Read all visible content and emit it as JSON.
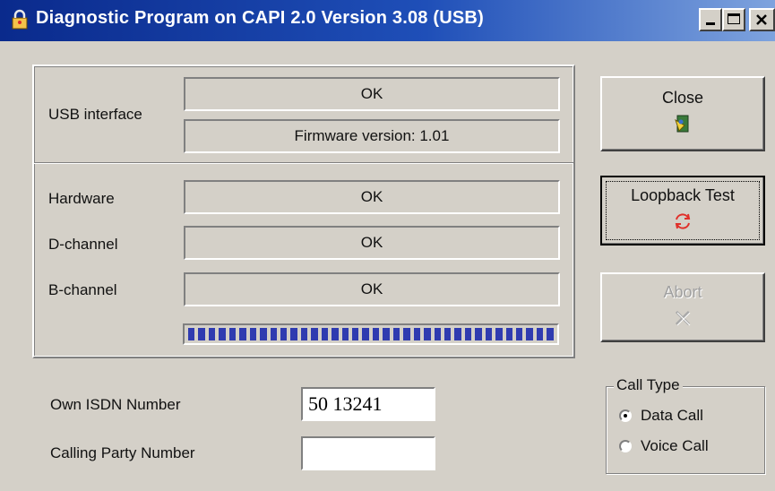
{
  "window": {
    "title": "Diagnostic Program on CAPI 2.0 Version 3.08 (USB)",
    "controls": [
      "minimize",
      "maximize",
      "close"
    ]
  },
  "status": {
    "usb_label": "USB interface",
    "usb_status": "OK",
    "firmware": "Firmware version: 1.01",
    "hardware_label": "Hardware",
    "hardware_status": "OK",
    "dchannel_label": "D-channel",
    "dchannel_status": "OK",
    "bchannel_label": "B-channel",
    "bchannel_status": "OK",
    "progress_percent": 100
  },
  "buttons": {
    "close_label": "Close",
    "loopback_label": "Loopback Test",
    "abort_label": "Abort"
  },
  "numbers": {
    "own_label": "Own ISDN Number",
    "own_value": "50 13241",
    "calling_label": "Calling Party Number",
    "calling_value": ""
  },
  "call_type": {
    "title": "Call Type",
    "options": [
      {
        "label": "Data Call",
        "selected": true
      },
      {
        "label": "Voice Call",
        "selected": false
      }
    ]
  },
  "colors": {
    "titlebar": "#0a2a8c",
    "progress": "#2f3bb0",
    "loop_icon": "#e0302a"
  }
}
